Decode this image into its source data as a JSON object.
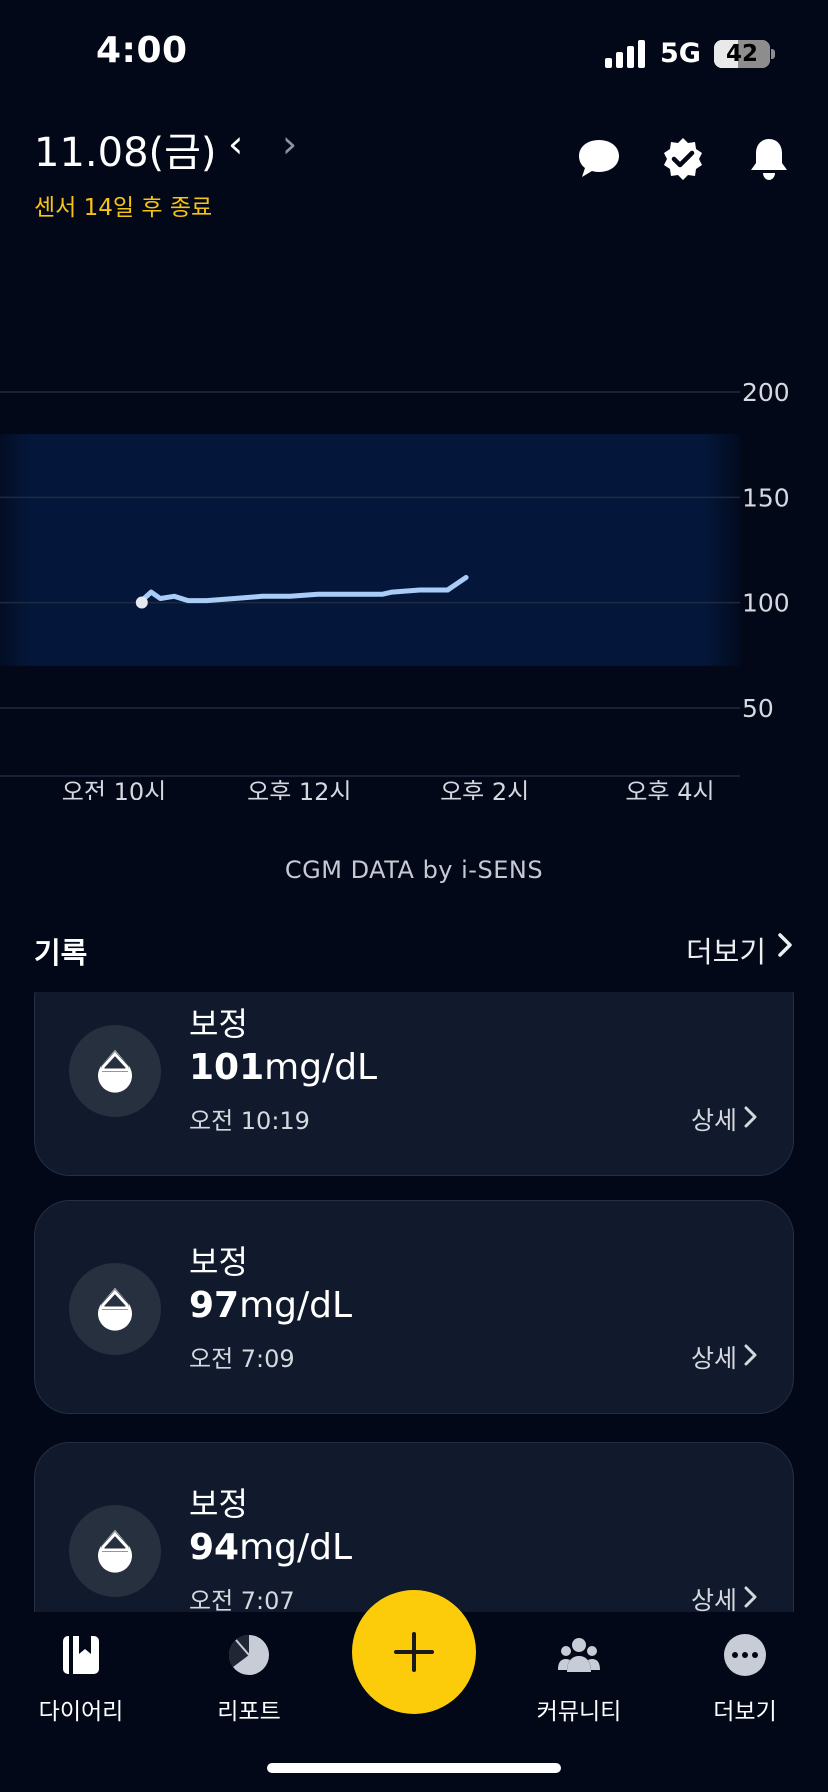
{
  "status_bar": {
    "time": "4:00",
    "network": "5G",
    "battery": "42",
    "battery_level": 0.42
  },
  "header": {
    "date": "11.08(금)",
    "prev_label": "‹",
    "next_label": "›",
    "sensor_notice": "센서 14일 후 종료",
    "icons": [
      "chat-icon",
      "verified-badge-icon",
      "bell-icon"
    ]
  },
  "chart_data": {
    "type": "line",
    "x_tick_labels": [
      "오전 10시",
      "오후 12시",
      "오후 2시",
      "오후 4시"
    ],
    "y_tick_labels": [
      "200",
      "150",
      "100",
      "50"
    ],
    "y_ticks": [
      200,
      150,
      100,
      50
    ],
    "ylim": [
      30,
      200
    ],
    "xlim_hours": [
      9.3,
      17.3
    ],
    "x_tick_hours": [
      10,
      12,
      14,
      16
    ],
    "target_range": [
      70,
      180
    ],
    "grid": true,
    "series": [
      {
        "x": [
          10.3,
          10.4,
          10.5,
          10.65,
          10.8,
          11.0,
          11.3,
          11.6,
          11.9,
          12.2,
          12.6,
          12.9,
          13.0,
          13.3,
          13.6,
          13.8
        ],
        "values": [
          101,
          105,
          102,
          103,
          101,
          101,
          102,
          103,
          103,
          104,
          104,
          104,
          105,
          106,
          106,
          112
        ]
      }
    ],
    "start_marker": {
      "x": 10.3,
      "value": 101
    }
  },
  "caption": "CGM DATA by i-SENS",
  "records": {
    "title": "기록",
    "more_label": "더보기",
    "items": [
      {
        "type": "보정",
        "value": "101",
        "unit": "mg/dL",
        "time": "오전 10:19",
        "detail": "상세"
      },
      {
        "type": "보정",
        "value": "97",
        "unit": "mg/dL",
        "time": "오전 7:09",
        "detail": "상세"
      },
      {
        "type": "보정",
        "value": "94",
        "unit": "mg/dL",
        "time": "오전 7:07",
        "detail": "상세"
      }
    ]
  },
  "tabs": [
    {
      "label": "다이어리",
      "icon": "diary-icon",
      "active": true
    },
    {
      "label": "리포트",
      "icon": "report-icon",
      "active": false
    },
    {
      "label": "커뮤니티",
      "icon": "community-icon",
      "active": false
    },
    {
      "label": "더보기",
      "icon": "more-icon",
      "active": false
    }
  ],
  "fab": {
    "icon": "plus-icon"
  },
  "colors": {
    "background": "#020818",
    "accent": "#fccc0a",
    "sensor_text": "#f6c412",
    "line": "#a9cdf6",
    "target_band": "#04173a",
    "card": "#101a2c"
  }
}
